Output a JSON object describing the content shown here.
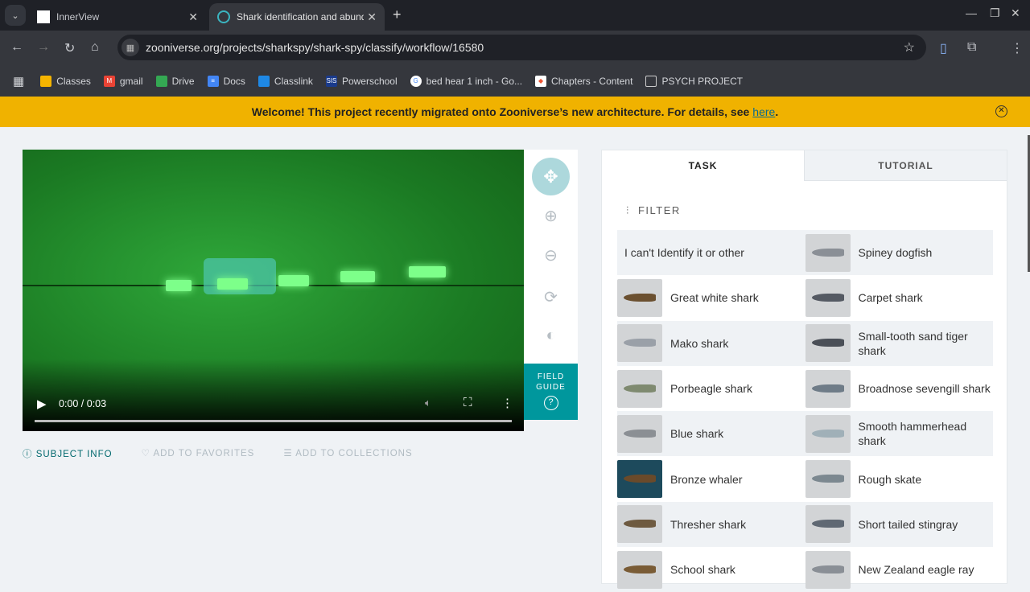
{
  "browser": {
    "tabs": [
      {
        "title": "InnerView"
      },
      {
        "title": "Shark identification and abundance"
      }
    ],
    "url": "zooniverse.org/projects/sharkspy/shark-spy/classify/workflow/16580",
    "bookmarks": [
      "Classes",
      "gmail",
      "Drive",
      "Docs",
      "Classlink",
      "Powerschool",
      "bed hear 1 inch - Go...",
      "Chapters - Content",
      "PSYCH PROJECT"
    ]
  },
  "banner": {
    "text": "Welcome! This project recently migrated onto Zooniverse’s new architecture. For details, see",
    "link": "here",
    "end": "."
  },
  "video": {
    "time": "0:00 / 0:03",
    "progress": 0
  },
  "field_guide": {
    "line1": "FIELD",
    "line2": "GUIDE",
    "q": "?"
  },
  "meta": {
    "subject_info": "SUBJECT INFO",
    "favorites": "ADD TO FAVORITES",
    "collections": "ADD TO COLLECTIONS"
  },
  "panel": {
    "tabs": [
      "TASK",
      "TUTORIAL"
    ],
    "filter": "FILTER",
    "choices": [
      "I can't Identify it or other",
      "Spiney dogfish",
      "Great white shark",
      "Carpet shark",
      "Mako shark",
      "Small-tooth sand tiger shark",
      "Porbeagle shark",
      "Broadnose sevengill shark",
      "Blue shark",
      "Smooth hammerhead shark",
      "Bronze whaler",
      "Rough skate",
      "Thresher shark",
      "Short tailed stingray",
      "School shark",
      "New Zealand eagle ray"
    ]
  },
  "colors": {
    "accent": "#00979d",
    "banner": "#f0b200"
  }
}
